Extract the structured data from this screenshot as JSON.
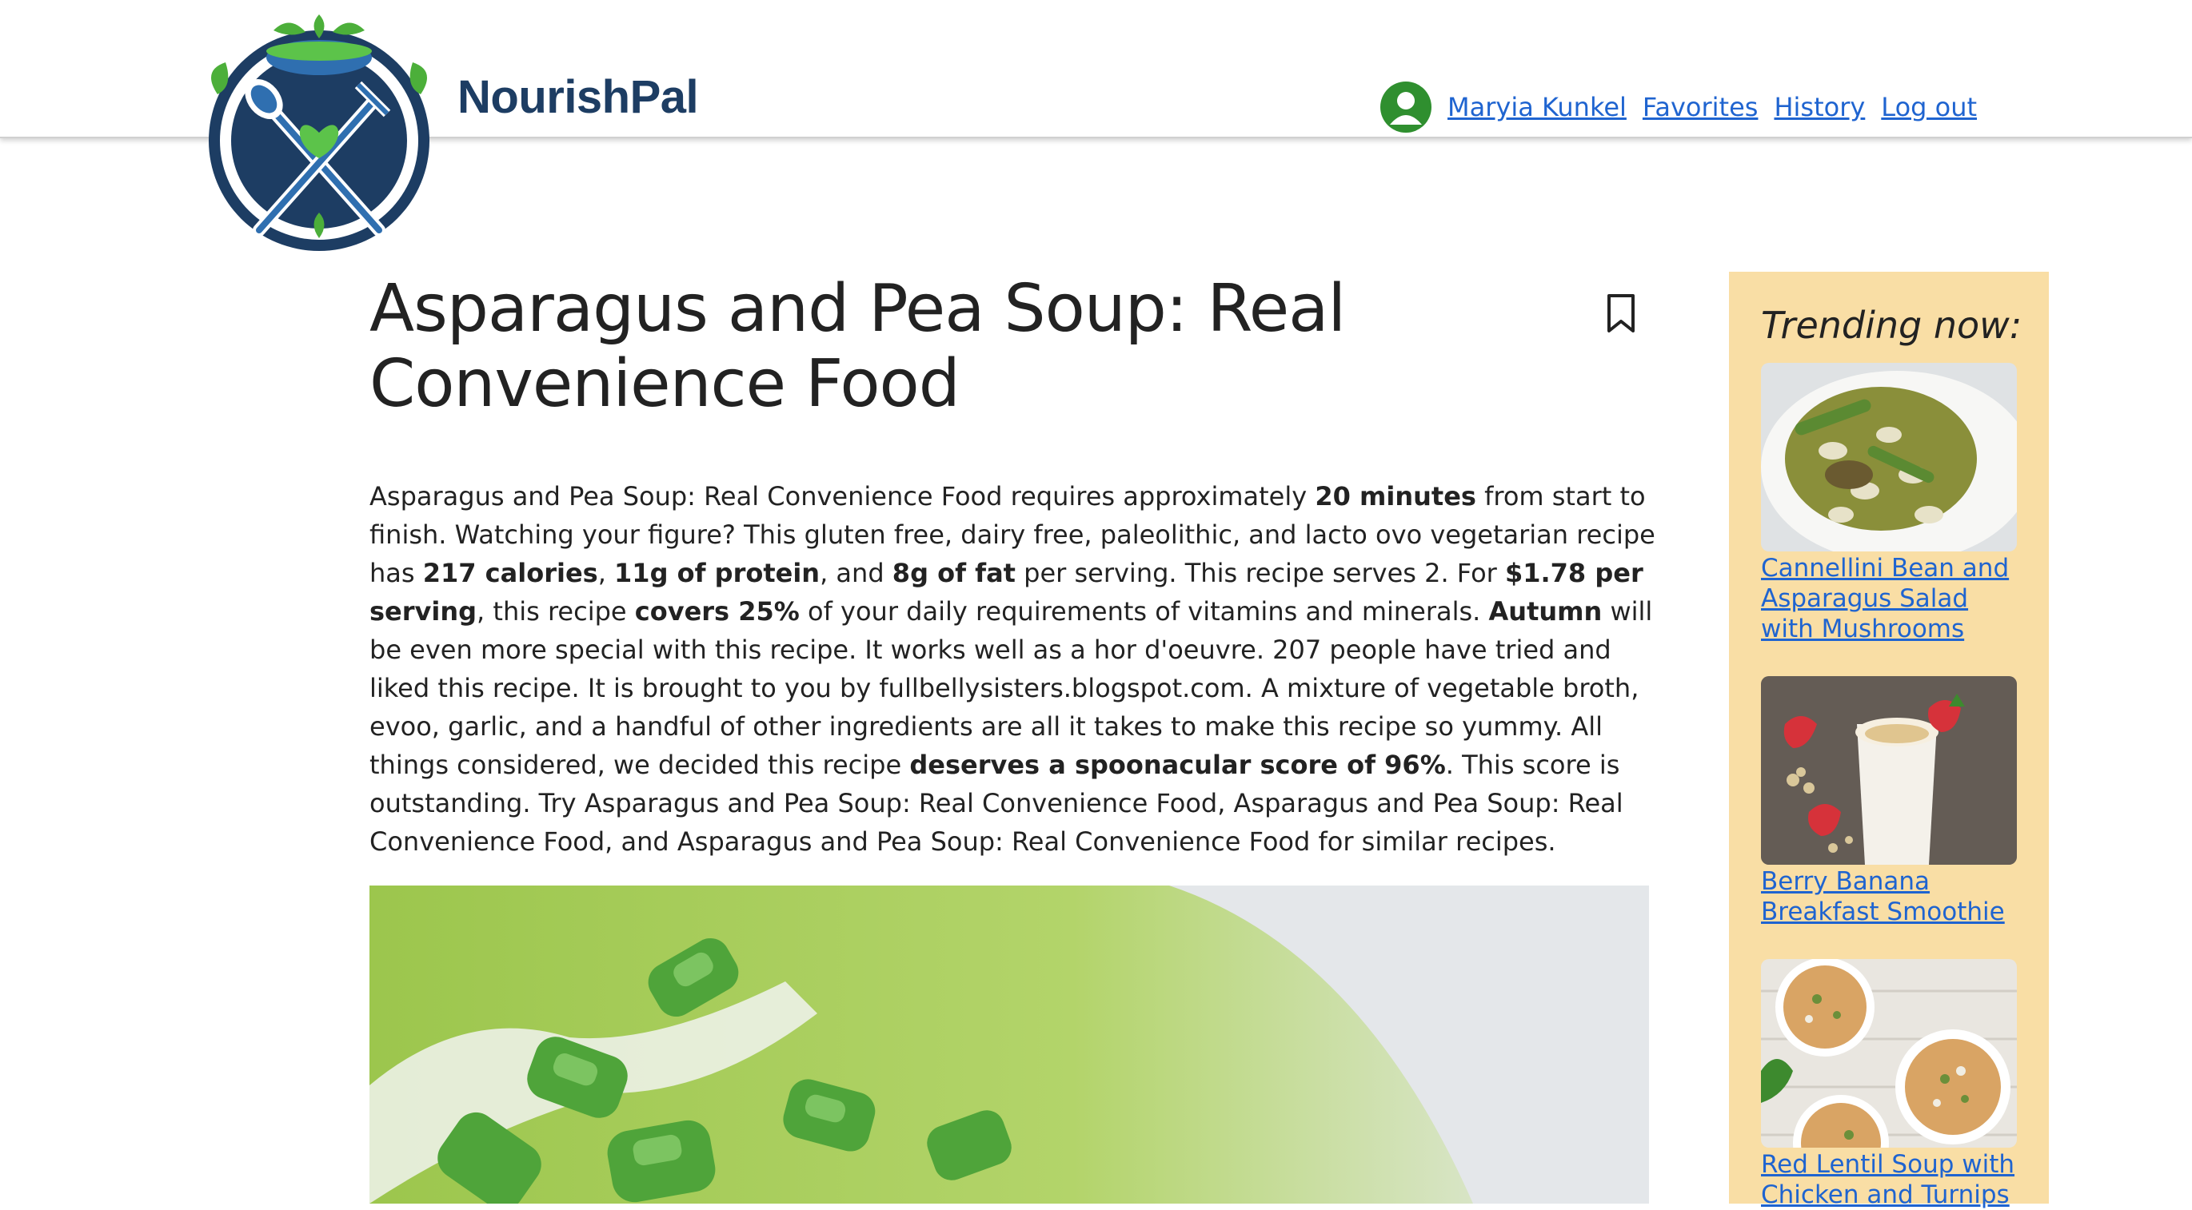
{
  "header": {
    "brand": "NourishPal",
    "user_name": "Maryia Kunkel",
    "favorites": "Favorites",
    "history": "History",
    "logout": "Log out"
  },
  "recipe": {
    "title": "Asparagus and Pea Soup: Real Convenience Food",
    "summary": [
      {
        "t": "Asparagus and Pea Soup: Real Convenience Food requires approximately "
      },
      {
        "t": "20 minutes",
        "b": true
      },
      {
        "t": " from start to finish. Watching your figure? This gluten free, dairy free, paleolithic, and lacto ovo vegetarian recipe has "
      },
      {
        "t": "217 calories",
        "b": true
      },
      {
        "t": ", "
      },
      {
        "t": "11g of protein",
        "b": true
      },
      {
        "t": ", and "
      },
      {
        "t": "8g of fat",
        "b": true
      },
      {
        "t": " per serving. This recipe serves 2. For "
      },
      {
        "t": "$1.78 per serving",
        "b": true
      },
      {
        "t": ", this recipe "
      },
      {
        "t": "covers 25%",
        "b": true
      },
      {
        "t": " of your daily requirements of vitamins and minerals. "
      },
      {
        "t": "Autumn",
        "b": true
      },
      {
        "t": " will be even more special with this recipe. It works well as a hor d'oeuvre. 207 people have tried and liked this recipe. It is brought to you by fullbellysisters.blogspot.com. A mixture of vegetable broth, evoo, garlic, and a handful of other ingredients are all it takes to make this recipe so yummy. All things considered, we decided this recipe "
      },
      {
        "t": "deserves a spoonacular score of 96%",
        "b": true
      },
      {
        "t": ". This score is outstanding. Try Asparagus and Pea Soup: Real Convenience Food, Asparagus and Pea Soup: Real Convenience Food, and Asparagus and Pea Soup: Real Convenience Food for similar recipes."
      }
    ]
  },
  "sidebar": {
    "title": "Trending now:",
    "items": [
      {
        "label": "Cannellini Bean and Asparagus Salad with Mushrooms"
      },
      {
        "label": "Berry Banana Breakfast Smoothie"
      },
      {
        "label": "Red Lentil Soup with Chicken and Turnips"
      }
    ]
  },
  "colors": {
    "brand": "#1d3d63",
    "link": "#1f64d0",
    "avatar": "#2f8f2f",
    "sidebar_bg": "#f9dea5"
  },
  "icons": {
    "avatar": "user-avatar-icon",
    "bookmark": "bookmark-icon"
  }
}
